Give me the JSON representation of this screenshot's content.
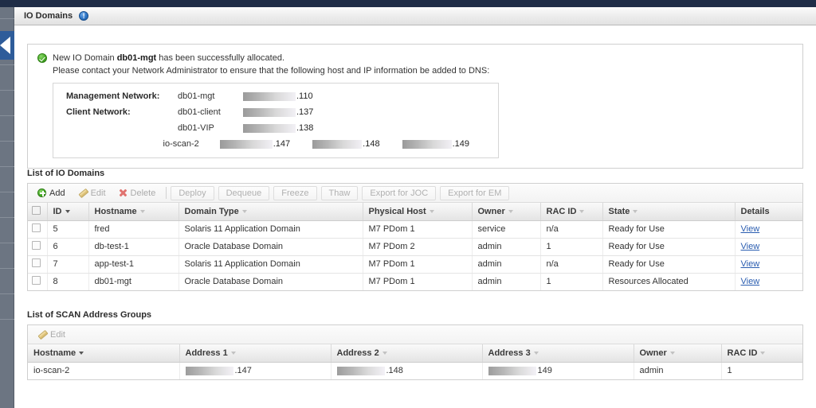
{
  "window": {
    "page_title": "IO Domains",
    "info_icon": "info-circle-icon",
    "collapse_arrow": "collapse-panel-arrow-icon"
  },
  "notification": {
    "status_icon": "success-check-icon",
    "message_prefix": "New IO Domain ",
    "message_domain": "db01-mgt",
    "message_suffix": " has been successfully allocated.",
    "message_line2": "Please contact your Network Administrator to ensure that the following host and IP information be added to DNS:",
    "network_rows": [
      {
        "label": "Management Network:",
        "hostname": "db01-mgt",
        "addresses": [
          ".110"
        ]
      },
      {
        "label": "Client Network:",
        "hostname": "db01-client",
        "addresses": [
          ".137"
        ]
      },
      {
        "label": "",
        "hostname": "db01-VIP",
        "addresses": [
          ".138"
        ]
      },
      {
        "label": "",
        "hostname": "io-scan-2",
        "addresses": [
          ".147",
          ".148",
          ".149"
        ]
      }
    ]
  },
  "io_domains": {
    "section_title": "List of IO Domains",
    "toolbar": {
      "add_label": "Add",
      "edit_label": "Edit",
      "delete_label": "Delete",
      "buttons": [
        {
          "label": "Deploy",
          "enabled": false
        },
        {
          "label": "Dequeue",
          "enabled": false
        },
        {
          "label": "Freeze",
          "enabled": false
        },
        {
          "label": "Thaw",
          "enabled": false
        },
        {
          "label": "Export for JOC",
          "enabled": false
        },
        {
          "label": "Export for EM",
          "enabled": false
        }
      ],
      "add_enabled": true,
      "edit_enabled": false,
      "delete_enabled": false
    },
    "columns": [
      {
        "label": "ID",
        "sorted": true
      },
      {
        "label": "Hostname",
        "sorted": false
      },
      {
        "label": "Domain Type",
        "sorted": false
      },
      {
        "label": "Physical Host",
        "sorted": false
      },
      {
        "label": "Owner",
        "sorted": false
      },
      {
        "label": "RAC ID",
        "sorted": false
      },
      {
        "label": "State",
        "sorted": false
      },
      {
        "label": "Details",
        "sorted": null
      }
    ],
    "rows": [
      {
        "id": "5",
        "hostname": "fred",
        "domain_type": "Solaris 11 Application Domain",
        "physical_host": "M7 PDom 1",
        "owner": "service",
        "rac_id": "n/a",
        "state": "Ready for Use",
        "details": "View"
      },
      {
        "id": "6",
        "hostname": "db-test-1",
        "domain_type": "Oracle Database Domain",
        "physical_host": "M7 PDom 2",
        "owner": "admin",
        "rac_id": "1",
        "state": "Ready for Use",
        "details": "View"
      },
      {
        "id": "7",
        "hostname": "app-test-1",
        "domain_type": "Solaris 11 Application Domain",
        "physical_host": "M7 PDom 1",
        "owner": "admin",
        "rac_id": "n/a",
        "state": "Ready for Use",
        "details": "View"
      },
      {
        "id": "8",
        "hostname": "db01-mgt",
        "domain_type": "Oracle Database Domain",
        "physical_host": "M7 PDom 1",
        "owner": "admin",
        "rac_id": "1",
        "state": "Resources Allocated",
        "details": "View"
      }
    ]
  },
  "scan_groups": {
    "section_title": "List of SCAN Address Groups",
    "toolbar": {
      "edit_label": "Edit",
      "edit_enabled": false
    },
    "columns": [
      {
        "label": "Hostname",
        "sorted": true
      },
      {
        "label": "Address 1",
        "sorted": false
      },
      {
        "label": "Address 2",
        "sorted": false
      },
      {
        "label": "Address 3",
        "sorted": false
      },
      {
        "label": "Owner",
        "sorted": false
      },
      {
        "label": "RAC ID",
        "sorted": false
      }
    ],
    "rows": [
      {
        "hostname": "io-scan-2",
        "address1": ".147",
        "address2": ".148",
        "address3": "149",
        "owner": "admin",
        "rac_id": "1"
      }
    ]
  },
  "colors": {
    "chrome_navy": "#1f2d47",
    "rail_gray": "#6c7582",
    "link_blue": "#2a5db0",
    "success_green": "#42a521",
    "accent_blue": "#2a72c4"
  }
}
